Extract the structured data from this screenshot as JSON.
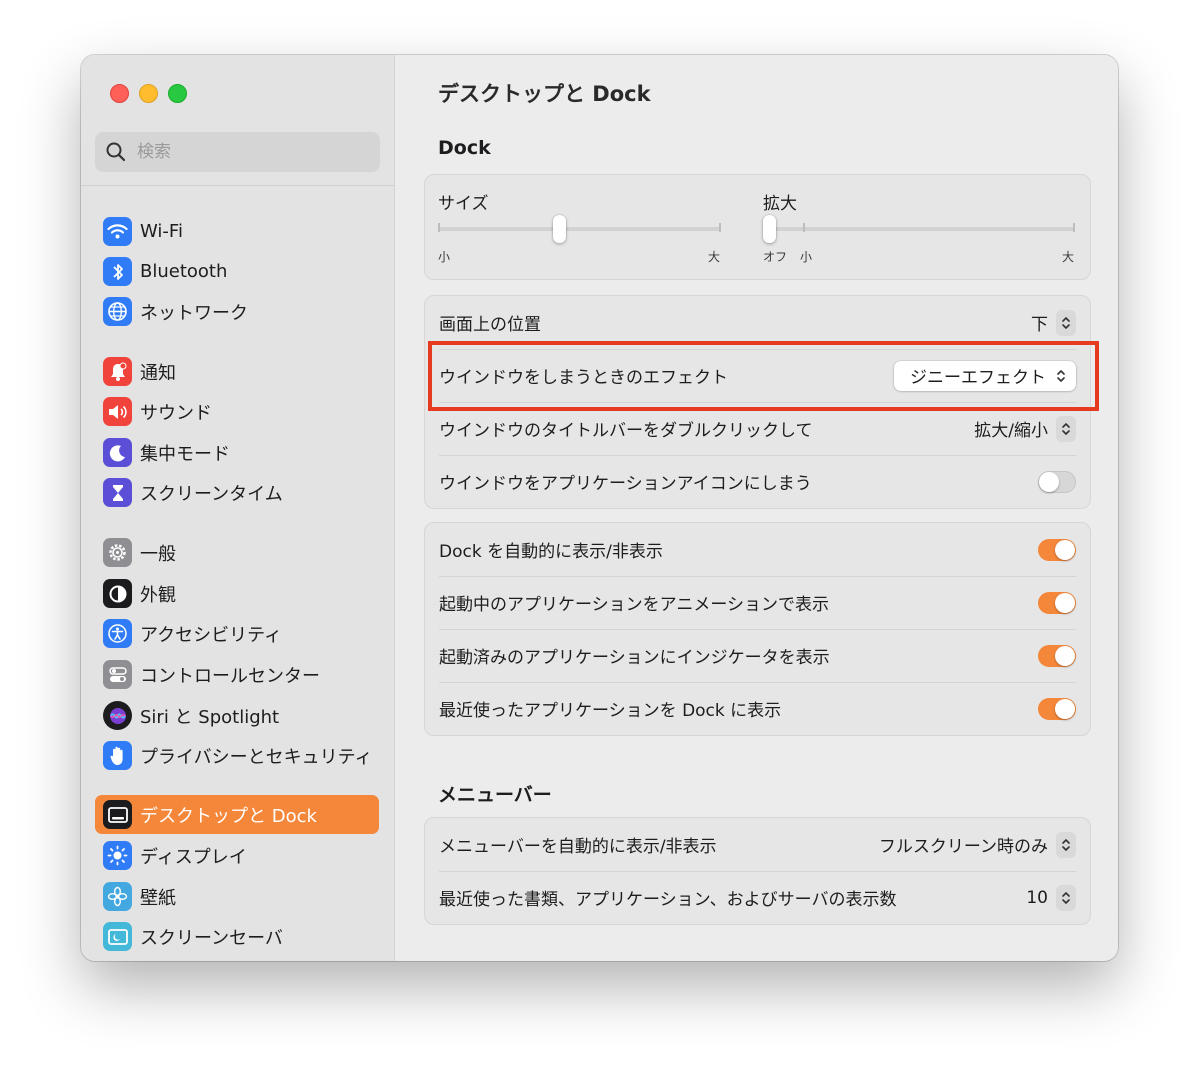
{
  "window": {
    "title": "デスクトップと Dock"
  },
  "search": {
    "placeholder": "検索",
    "icon": "magnifier-icon"
  },
  "sidebar": {
    "items": [
      {
        "label": "Wi-Fi",
        "icon": "wifi-icon",
        "color": "#2f7cf6"
      },
      {
        "label": "Bluetooth",
        "icon": "bluetooth-icon",
        "color": "#2f7cf6"
      },
      {
        "label": "ネットワーク",
        "icon": "globe-icon",
        "color": "#2f7cf6"
      },
      {
        "label": "通知",
        "icon": "bell-icon",
        "color": "#f0433c"
      },
      {
        "label": "サウンド",
        "icon": "speaker-icon",
        "color": "#f0433c"
      },
      {
        "label": "集中モード",
        "icon": "moon-icon",
        "color": "#5a4fd6"
      },
      {
        "label": "スクリーンタイム",
        "icon": "hourglass-icon",
        "color": "#5a4fd6"
      },
      {
        "label": "一般",
        "icon": "gear-icon",
        "color": "#8e8e93"
      },
      {
        "label": "外観",
        "icon": "appearance-icon",
        "color": "#1c1c1e"
      },
      {
        "label": "アクセシビリティ",
        "icon": "accessibility-icon",
        "color": "#2f7cf6"
      },
      {
        "label": "コントロールセンター",
        "icon": "switches-icon",
        "color": "#8e8e93"
      },
      {
        "label": "Siri と Spotlight",
        "icon": "siri-icon",
        "color": "#7a3fd0"
      },
      {
        "label": "プライバシーとセキュリティ",
        "icon": "hand-icon",
        "color": "#2f7cf6"
      },
      {
        "label": "デスクトップと Dock",
        "icon": "dock-icon",
        "color": "#1c1c1e",
        "active": true
      },
      {
        "label": "ディスプレイ",
        "icon": "sun-icon",
        "color": "#2f7cf6"
      },
      {
        "label": "壁紙",
        "icon": "flower-icon",
        "color": "#43a8e0"
      },
      {
        "label": "スクリーンセーバ",
        "icon": "screensaver-icon",
        "color": "#43b8d9"
      }
    ]
  },
  "dock_section": {
    "title": "Dock",
    "size": {
      "label": "サイズ",
      "min_label": "小",
      "max_label": "大",
      "value": 0.43
    },
    "magnify": {
      "label": "拡大",
      "off_label": "オフ",
      "min_label": "小",
      "max_label": "大",
      "value": 0.0
    }
  },
  "position_group": {
    "rows": [
      {
        "label": "画面上の位置",
        "value": "下"
      },
      {
        "label": "ウインドウをしまうときのエフェクト",
        "value": "ジニーエフェクト"
      },
      {
        "label": "ウインドウのタイトルバーをダブルクリックして",
        "value": "拡大/縮小"
      },
      {
        "label": "ウインドウをアプリケーションアイコンにしまう",
        "toggle": false
      }
    ]
  },
  "toggle_group": {
    "rows": [
      {
        "label": "Dock を自動的に表示/非表示",
        "toggle": true
      },
      {
        "label": "起動中のアプリケーションをアニメーションで表示",
        "toggle": true
      },
      {
        "label": "起動済みのアプリケーションにインジケータを表示",
        "toggle": true
      },
      {
        "label": "最近使ったアプリケーションを Dock に表示",
        "toggle": true
      }
    ]
  },
  "menubar_section": {
    "title": "メニューバー",
    "rows": [
      {
        "label": "メニューバーを自動的に表示/非表示",
        "value": "フルスクリーン時のみ"
      },
      {
        "label": "最近使った書類、アプリケーション、およびサーバの表示数",
        "value": "10"
      }
    ]
  },
  "colors": {
    "accent": "#f4873a",
    "highlight": "#e53a20"
  }
}
